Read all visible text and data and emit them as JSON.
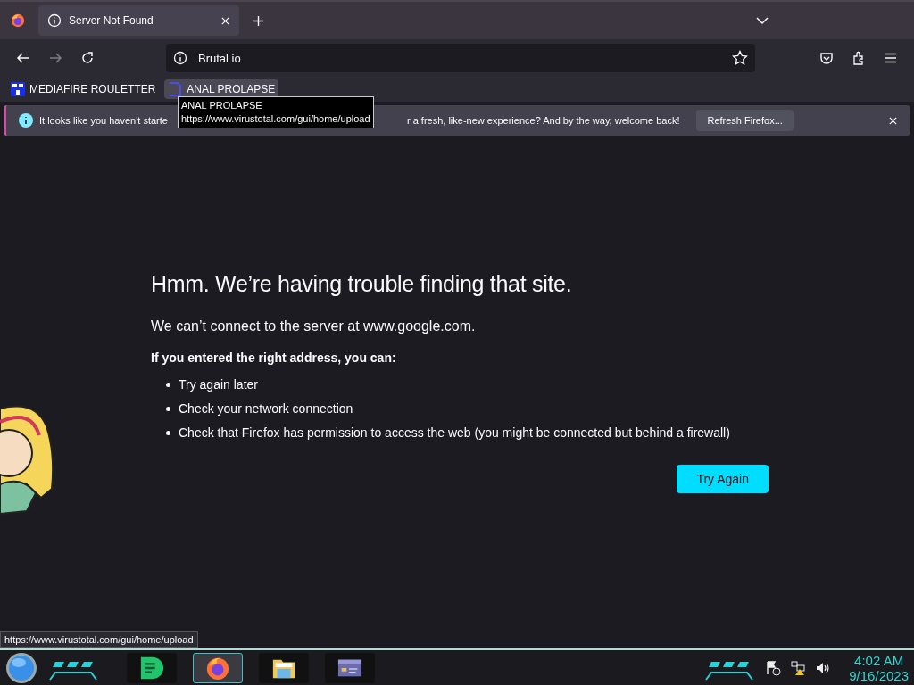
{
  "tabs": [
    {
      "title": "Server Not Found",
      "selected": true
    }
  ],
  "address": {
    "value": "Brutal io"
  },
  "bookmarks": [
    {
      "label": "MEDIAFIRE ROULETTER",
      "kind": "mft",
      "hovered": false
    },
    {
      "label": "ANAL PROLAPSE",
      "kind": "bracket",
      "hovered": true
    }
  ],
  "tooltip": {
    "title": "ANAL PROLAPSE",
    "url": "https://www.virustotal.com/gui/home/upload"
  },
  "notification": {
    "text_start": "It looks like you haven't starte",
    "text_end": "r a fresh, like-new experience? And by the way, welcome back!",
    "button": "Refresh Firefox..."
  },
  "error": {
    "heading": "Hmm. We’re having trouble finding that site.",
    "message": "We can’t connect to the server at www.google.com.",
    "advice_heading": "If you entered the right address, you can:",
    "advice": [
      "Try again later",
      "Check your network connection",
      "Check that Firefox has permission to access the web (you might be connected but behind a firewall)"
    ],
    "button": "Try Again"
  },
  "status_url": "https://www.virustotal.com/gui/home/upload",
  "taskbar": {
    "apps": [
      {
        "kind": "music",
        "selected": false
      },
      {
        "kind": "browser",
        "selected": true
      },
      {
        "kind": "folder",
        "selected": false
      },
      {
        "kind": "window",
        "selected": false
      }
    ],
    "clock": {
      "time": "4:02 AM",
      "date": "9/16/2023"
    }
  }
}
